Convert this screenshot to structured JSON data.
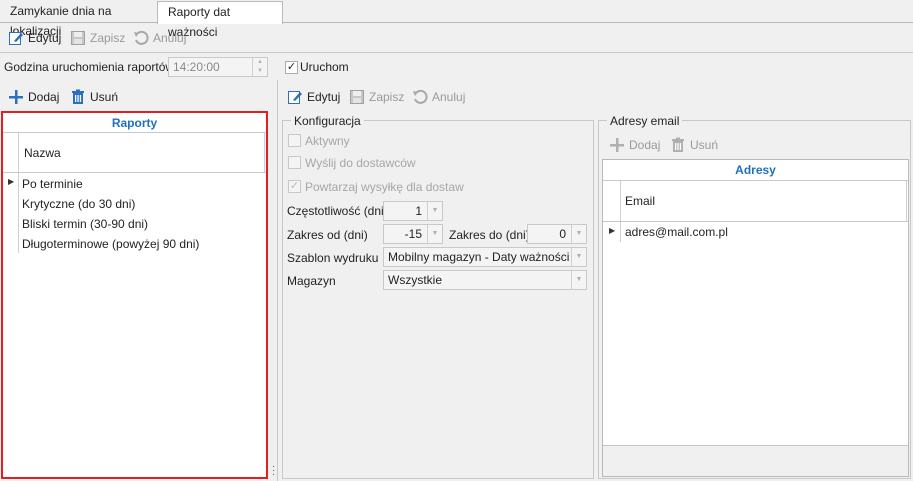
{
  "tabs": [
    {
      "label": "Zamykanie dnia na lokalizacji"
    },
    {
      "label": "Raporty dat ważności"
    }
  ],
  "top_toolbar": {
    "edit_label": "Edytuj",
    "save_label": "Zapisz",
    "cancel_label": "Anuluj"
  },
  "schedule": {
    "time_label": "Godzina uruchomienia raportów",
    "time_value": "14:20:00",
    "run_label": "Uruchom",
    "run_checked": true
  },
  "reports_toolbar": {
    "add_label": "Dodaj",
    "delete_label": "Usuń"
  },
  "reports_grid": {
    "title": "Raporty",
    "column": "Nazwa",
    "rows": [
      "Po terminie",
      "Krytyczne (do 30 dni)",
      "Bliski termin (30-90 dni)",
      "Długoterminowe (powyżej 90 dni)"
    ]
  },
  "detail_toolbar": {
    "edit_label": "Edytuj",
    "save_label": "Zapisz",
    "cancel_label": "Anuluj"
  },
  "config": {
    "title": "Konfiguracja",
    "active_label": "Aktywny",
    "send_to_suppliers_label": "Wyślij do dostawców",
    "repeat_label": "Powtarzaj wysyłkę dla dostaw",
    "frequency_label": "Częstotliwość (dni)",
    "frequency_value": "1",
    "range_from_label": "Zakres od (dni)",
    "range_from_value": "-15",
    "range_to_label": "Zakres do (dni)",
    "range_to_value": "0",
    "template_label": "Szablon wydruku",
    "template_value": "Mobilny magazyn - Daty ważności (...",
    "warehouse_label": "Magazyn",
    "warehouse_value": "Wszystkie"
  },
  "emails": {
    "title": "Adresy email",
    "add_label": "Dodaj",
    "delete_label": "Usuń",
    "grid_title": "Adresy",
    "column": "Email",
    "rows": [
      "adres@mail.com.pl"
    ]
  },
  "colors": {
    "accent": "#2070c0",
    "selection_border": "#e02020",
    "add_icon": "#2a6fc0",
    "delete_icon": "#2a6fc0"
  }
}
